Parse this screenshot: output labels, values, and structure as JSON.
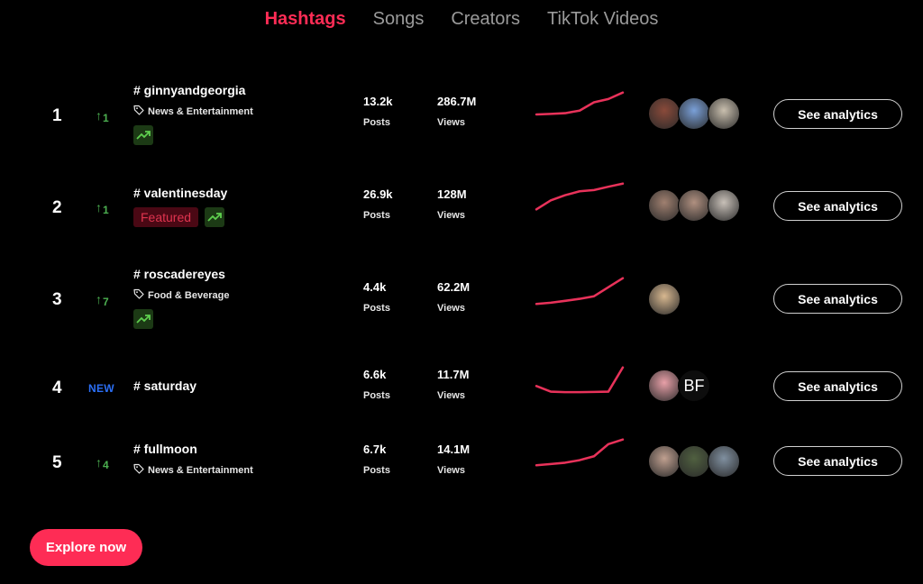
{
  "tabs": [
    {
      "label": "Hashtags",
      "active": true
    },
    {
      "label": "Songs",
      "active": false
    },
    {
      "label": "Creators",
      "active": false
    },
    {
      "label": "TikTok Videos",
      "active": false
    }
  ],
  "colors": {
    "accent": "#fe2c55",
    "up": "#4caf50",
    "new": "#2b6ff5",
    "trend_bg": "#1c3a15",
    "featured_bg": "#4a0814",
    "featured_text": "#e0344f"
  },
  "rows": [
    {
      "rank": "1",
      "change_type": "up",
      "change": "1",
      "hashtag": "# ginnyandgeorgia",
      "category": "News & Entertainment",
      "featured": false,
      "trending_icon": true,
      "posts": "13.2k",
      "posts_label": "Posts",
      "views": "286.7M",
      "views_label": "Views",
      "trend": [
        0.15,
        0.17,
        0.2,
        0.3,
        0.62,
        0.75,
        1.0
      ],
      "avatars": [
        "#8a4a3a",
        "#7aa0d8",
        "#c9bfae"
      ],
      "button": "See analytics"
    },
    {
      "rank": "2",
      "change_type": "up",
      "change": "1",
      "hashtag": "# valentinesday",
      "category": "",
      "featured": true,
      "featured_label": "Featured",
      "trending_icon": true,
      "posts": "26.9k",
      "posts_label": "Posts",
      "views": "128M",
      "views_label": "Views",
      "trend": [
        0.0,
        0.35,
        0.55,
        0.7,
        0.75,
        0.88,
        1.0
      ],
      "avatars": [
        "#a08070",
        "#b09080",
        "#c8c0b8"
      ],
      "button": "See analytics"
    },
    {
      "rank": "3",
      "change_type": "up",
      "change": "7",
      "hashtag": "# roscadereyes",
      "category": "Food & Beverage",
      "featured": false,
      "trending_icon": true,
      "posts": "4.4k",
      "posts_label": "Posts",
      "views": "62.2M",
      "views_label": "Views",
      "trend": [
        0.0,
        0.05,
        0.12,
        0.2,
        0.3,
        0.65,
        1.0
      ],
      "avatars": [
        "#d8b890"
      ],
      "button": "See analytics"
    },
    {
      "rank": "4",
      "change_type": "new",
      "change": "NEW",
      "hashtag": "# saturday",
      "category": "",
      "featured": false,
      "trending_icon": false,
      "posts": "6.6k",
      "posts_label": "Posts",
      "views": "11.7M",
      "views_label": "Views",
      "trend": [
        0.28,
        0.06,
        0.04,
        0.04,
        0.05,
        0.06,
        1.0
      ],
      "avatars": [
        "#e8a0a8"
      ],
      "avatar_text": "BF",
      "button": "See analytics"
    },
    {
      "rank": "5",
      "change_type": "up",
      "change": "4",
      "hashtag": "# fullmoon",
      "category": "News & Entertainment",
      "featured": false,
      "trending_icon": false,
      "posts": "6.7k",
      "posts_label": "Posts",
      "views": "14.1M",
      "views_label": "Views",
      "trend": [
        0.0,
        0.05,
        0.1,
        0.2,
        0.35,
        0.82,
        1.0
      ],
      "avatars": [
        "#c0a090",
        "#506040",
        "#8090a0"
      ],
      "button": "See analytics"
    }
  ],
  "explore_button": "Explore now"
}
